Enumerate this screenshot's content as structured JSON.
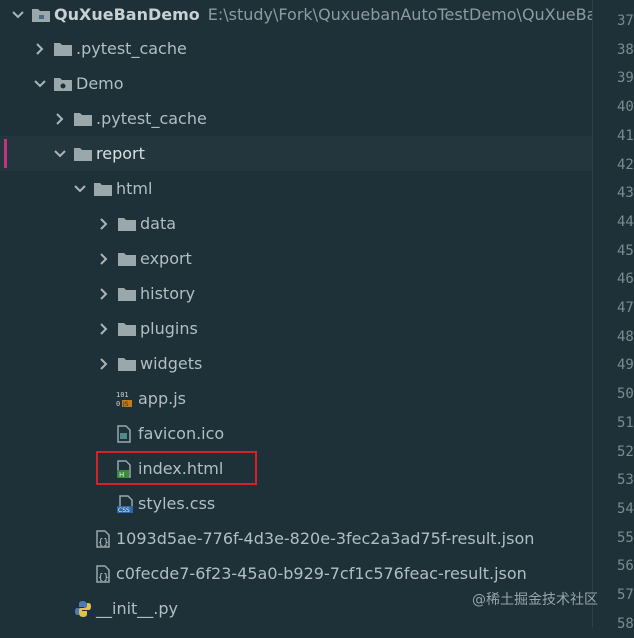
{
  "project": {
    "name": "QuXueBanDemo",
    "path": "E:\\study\\Fork\\QuxuebanAutoTestDemo\\QuXueBanDemo"
  },
  "tree": [
    {
      "label": ".pytest_cache",
      "icon": "folder-icon",
      "arrow": "right"
    },
    {
      "label": "Demo",
      "icon": "package-folder-icon",
      "arrow": "down"
    },
    {
      "label": ".pytest_cache",
      "icon": "folder-icon",
      "arrow": "right"
    },
    {
      "label": "report",
      "icon": "folder-icon",
      "arrow": "down",
      "selected": true
    },
    {
      "label": "html",
      "icon": "folder-icon",
      "arrow": "down"
    },
    {
      "label": "data",
      "icon": "folder-icon",
      "arrow": "right"
    },
    {
      "label": "export",
      "icon": "folder-icon",
      "arrow": "right"
    },
    {
      "label": "history",
      "icon": "folder-icon",
      "arrow": "right"
    },
    {
      "label": "plugins",
      "icon": "folder-icon",
      "arrow": "right"
    },
    {
      "label": "widgets",
      "icon": "folder-icon",
      "arrow": "right"
    },
    {
      "label": "app.js",
      "icon": "javascript-file-icon"
    },
    {
      "label": "favicon.ico",
      "icon": "image-file-icon"
    },
    {
      "label": "index.html",
      "icon": "html-file-icon"
    },
    {
      "label": "styles.css",
      "icon": "css-file-icon"
    },
    {
      "label": "1093d5ae-776f-4d3e-820e-3fec2a3ad75f-result.json",
      "icon": "json-file-icon"
    },
    {
      "label": "c0fecde7-6f23-45a0-b929-7cf1c576feac-result.json",
      "icon": "json-file-icon"
    },
    {
      "label": "__init__.py",
      "icon": "python-file-icon"
    }
  ],
  "line_numbers": [
    "37",
    "38",
    "39",
    "40",
    "41",
    "42",
    "43",
    "44",
    "45",
    "46",
    "47",
    "48",
    "49",
    "50",
    "51",
    "52",
    "53",
    "54",
    "55",
    "56",
    "57",
    "58"
  ],
  "watermark": "@稀土掘金技术社区",
  "colors": {
    "background": "#1e3138",
    "selection_marker": "#c2357e",
    "highlight_box": "#d6202a",
    "folder": "#9aa7ab"
  }
}
